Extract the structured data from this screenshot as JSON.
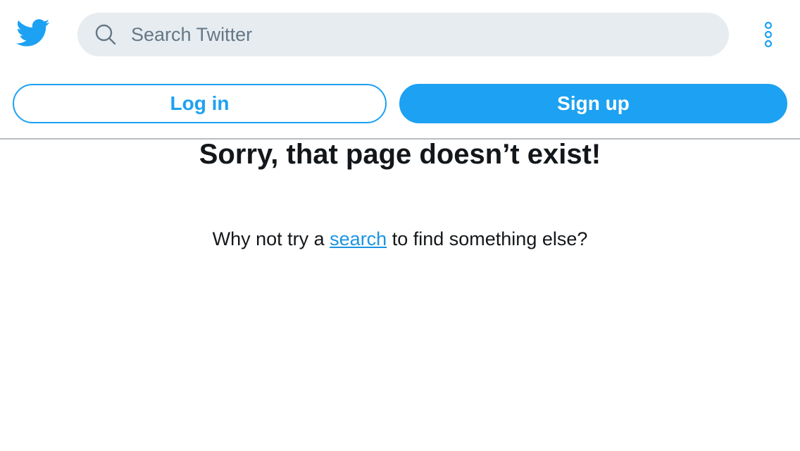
{
  "header": {
    "logo_icon": "twitter-bird-icon",
    "search": {
      "icon": "search-icon",
      "placeholder": "Search Twitter",
      "value": ""
    },
    "more_icon": "more-vertical-icon"
  },
  "actions": {
    "login_label": "Log in",
    "signup_label": "Sign up"
  },
  "error": {
    "title": "Sorry, that page doesn’t exist!",
    "message_prefix": "Why not try a ",
    "message_link": "search",
    "message_suffix": " to find something else?"
  },
  "colors": {
    "brand": "#1da1f2",
    "link": "#1b95e0",
    "search_bg": "#e6ecf0",
    "text": "#14171a",
    "placeholder": "#657786"
  }
}
